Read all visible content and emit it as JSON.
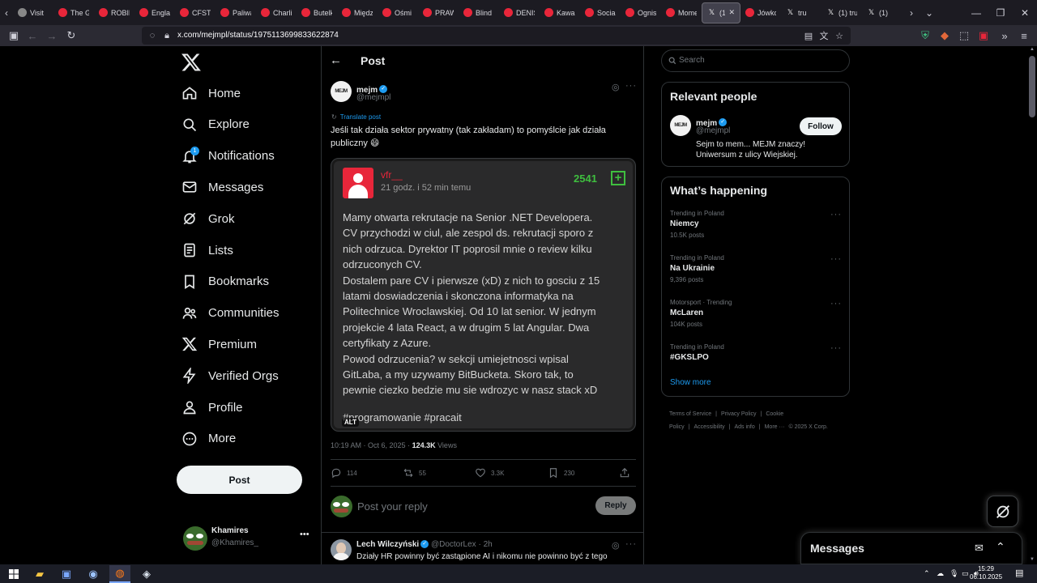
{
  "browser": {
    "tabs": [
      {
        "title": "Visit",
        "color": "#888888"
      },
      {
        "title": "The G",
        "color": "#e8263a"
      },
      {
        "title": "ROBIN",
        "color": "#e8263a"
      },
      {
        "title": "Engla",
        "color": "#e8263a"
      },
      {
        "title": "CFSTV",
        "color": "#e8263a"
      },
      {
        "title": "Paliwa",
        "color": "#e8263a"
      },
      {
        "title": "Charli",
        "color": "#e8263a"
      },
      {
        "title": "Butelk",
        "color": "#e8263a"
      },
      {
        "title": "Między",
        "color": "#e8263a"
      },
      {
        "title": "Ośmi",
        "color": "#e8263a"
      },
      {
        "title": "PRAW",
        "color": "#e8263a"
      },
      {
        "title": "Blind",
        "color": "#e8263a"
      },
      {
        "title": "DENIS",
        "color": "#e8263a"
      },
      {
        "title": "Kawal",
        "color": "#e8263a"
      },
      {
        "title": "Social",
        "color": "#e8263a"
      },
      {
        "title": "Ognis",
        "color": "#e8263a"
      },
      {
        "title": "Mome",
        "color": "#e8263a"
      },
      {
        "title": "(1)",
        "color": "#ffffff",
        "active": true
      },
      {
        "title": "Jówko",
        "color": "#e8263a"
      },
      {
        "title": "tru",
        "color": "#ffffff"
      },
      {
        "title": "(1) tru",
        "color": "#ffffff"
      },
      {
        "title": "(1)",
        "color": "#ffffff"
      }
    ],
    "url": "x.com/mejmpl/status/1975113699833622874"
  },
  "sidebar": {
    "items": [
      {
        "label": "Home",
        "icon": "home-icon"
      },
      {
        "label": "Explore",
        "icon": "search-icon"
      },
      {
        "label": "Notifications",
        "icon": "bell-icon",
        "badge": "1"
      },
      {
        "label": "Messages",
        "icon": "envelope-icon"
      },
      {
        "label": "Grok",
        "icon": "grok-icon"
      },
      {
        "label": "Lists",
        "icon": "list-icon"
      },
      {
        "label": "Bookmarks",
        "icon": "bookmark-icon"
      },
      {
        "label": "Communities",
        "icon": "people-icon"
      },
      {
        "label": "Premium",
        "icon": "x-icon"
      },
      {
        "label": "Verified Orgs",
        "icon": "lightning-icon"
      },
      {
        "label": "Profile",
        "icon": "person-icon"
      },
      {
        "label": "More",
        "icon": "more-circle-icon"
      }
    ],
    "post_button": "Post",
    "account": {
      "name": "Khamires",
      "handle": "@Khamires_"
    }
  },
  "post": {
    "header_title": "Post",
    "author_name": "mejm",
    "author_handle": "@mejmpl",
    "translate_label": "Translate post",
    "text": "Jeśli tak działa sektor prywatny (tak zakładam) to pomyślcie jak działa publiczny 😄",
    "embed": {
      "user": "vfr__",
      "time": "21 godz. i 52 min temu",
      "score": "2541",
      "body_lines": [
        "Mamy otwarta rekrutacje na Senior .NET Developera.",
        "CV przychodzi w ciul, ale zespol ds. rekrutacji sporo z",
        "nich odrzuca. Dyrektor IT poprosil mnie o review kilku",
        "odrzuconych CV.",
        "Dostalem pare CV i pierwsze (xD) z nich to gosciu z 15",
        "latami doswiadczenia i skonczona informatyka na",
        "Politechnice Wroclawskiej. Od 10 lat senior. W jednym",
        "projekcie 4 lata React, a w drugim 5 lat Angular. Dwa",
        "certyfikaty z Azure.",
        "Powod odrzucenia? w sekcji umiejetnosci wpisal",
        "GitLaba, a my uzywamy BitBucketa. Skoro tak, to",
        "pewnie ciezko bedzie mu sie wdrozyc w nasz stack xD"
      ],
      "tags": "#programowanie #pracait",
      "alt_label": "ALT"
    },
    "timestamp": "10:19 AM · Oct 6, 2025 · ",
    "views_count": "124.3K",
    "views_label": " Views",
    "stats": {
      "replies": "114",
      "reposts": "55",
      "likes": "3.3K",
      "bookmarks": "230"
    },
    "reply_placeholder": "Post your reply",
    "reply_button": "Reply"
  },
  "next_reply": {
    "name": "Lech Wilczyński",
    "handle": "@DoctorLex · 2h",
    "text": "Działy HR powinny być zastąpione AI i nikomu nie powinno być z tego"
  },
  "right": {
    "search_placeholder": "Search",
    "relevant_title": "Relevant people",
    "person": {
      "name": "mejm",
      "handle": "@mejmpl",
      "follow_label": "Follow",
      "bio": "Sejm to mem... MEJM znaczy! Uniwersum z ulicy Wiejskiej."
    },
    "happening_title": "What’s happening",
    "trends": [
      {
        "context": "Trending in Poland",
        "topic": "Niemcy",
        "count": "10.5K posts"
      },
      {
        "context": "Trending in Poland",
        "topic": "Na Ukrainie",
        "count": "9,396 posts"
      },
      {
        "context": "Motorsport · Trending",
        "topic": "McLaren",
        "count": "104K posts"
      },
      {
        "context": "Trending in Poland",
        "topic": "#GKSLPO",
        "count": ""
      }
    ],
    "show_more": "Show more",
    "footer": [
      "Terms of Service",
      "|",
      "Privacy Policy",
      "|",
      "Cookie Policy",
      "|",
      "Accessibility",
      "|",
      "Ads info",
      "|",
      "More ···",
      "© 2025 X Corp."
    ]
  },
  "messages_drawer": {
    "title": "Messages"
  },
  "taskbar": {
    "time": "15:29",
    "date": "06.10.2025"
  }
}
